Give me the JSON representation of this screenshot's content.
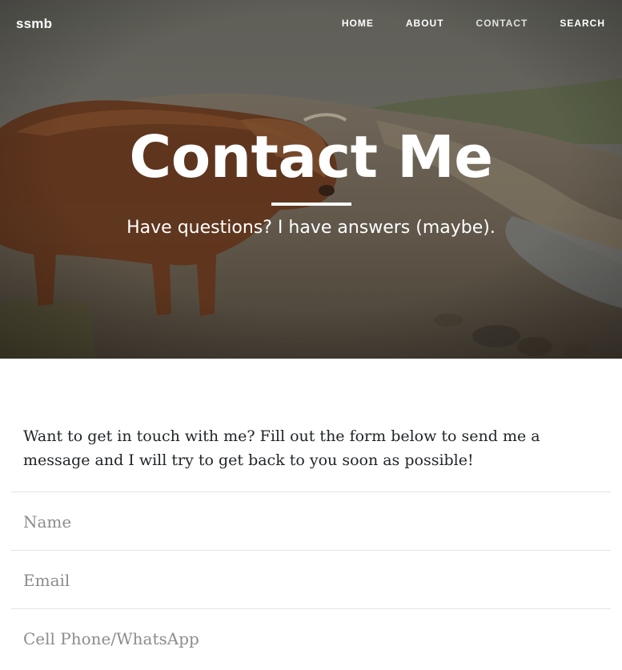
{
  "navbar": {
    "brand": "ssmb",
    "links": [
      {
        "label": "HOME"
      },
      {
        "label": "ABOUT"
      },
      {
        "label": "CONTACT",
        "active": true
      },
      {
        "label": "SEARCH"
      }
    ]
  },
  "hero": {
    "title": "Contact Me",
    "subtitle": "Have questions? I have answers (maybe)."
  },
  "content": {
    "intro": "Want to get in touch with me? Fill out the form below to send me a message and I will try to get back to you soon as possible!",
    "form": {
      "name_placeholder": "Name",
      "email_placeholder": "Email",
      "phone_placeholder": "Cell Phone/WhatsApp"
    }
  }
}
